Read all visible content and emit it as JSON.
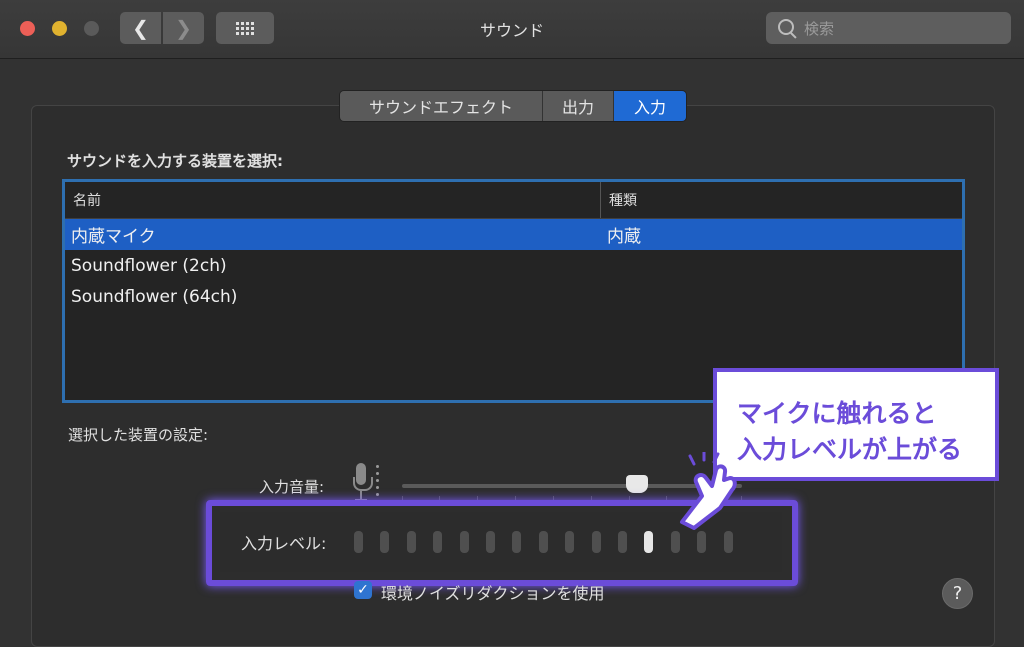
{
  "window": {
    "title": "サウンド"
  },
  "search": {
    "placeholder": "検索"
  },
  "tabs": [
    {
      "label": "サウンドエフェクト",
      "selected": false
    },
    {
      "label": "出力",
      "selected": false
    },
    {
      "label": "入力",
      "selected": true
    }
  ],
  "device_section": {
    "heading": "サウンドを入力する装置を選択:",
    "columns": [
      "名前",
      "種類"
    ],
    "rows": [
      {
        "name": "内蔵マイク",
        "type": "内蔵",
        "selected": true
      },
      {
        "name": "Soundflower (2ch)",
        "type": "",
        "selected": false
      },
      {
        "name": "Soundflower (64ch)",
        "type": "",
        "selected": false
      }
    ]
  },
  "settings": {
    "heading": "選択した装置の設定:",
    "input_volume_label": "入力音量:",
    "input_volume_value": 0.69,
    "input_level_label": "入力レベル:",
    "input_level_bars_total": 15,
    "input_level_bars_active": 12,
    "noise_reduction_label": "環境ノイズリダクションを使用",
    "noise_reduction_checked": true
  },
  "help": {
    "label": "?"
  },
  "annotation": {
    "line1": "マイクに触れると",
    "line2": "入力レベルが上がる"
  },
  "colors": {
    "accent_blue": "#1f6ad4",
    "annotation_purple": "#6b4cd9"
  },
  "icons": {
    "search": "search-icon",
    "back": "chevron-left-icon",
    "forward": "chevron-right-icon",
    "grid": "grid-icon",
    "mic": "microphone-icon",
    "hand": "pointing-hand-icon",
    "help": "question-icon"
  }
}
